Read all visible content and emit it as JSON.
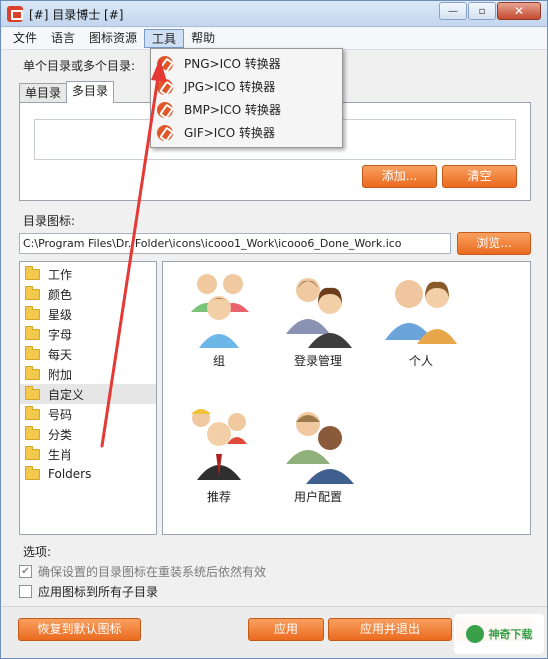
{
  "window": {
    "title": "[#] 目录博士 [#]",
    "minimize_glyph": "—",
    "maximize_glyph": "▫",
    "close_glyph": "✕"
  },
  "menu": {
    "items": [
      "文件",
      "语言",
      "图标资源",
      "工具",
      "帮助"
    ],
    "active_index": 3
  },
  "tools_menu": {
    "items": [
      "PNG>ICO 转换器",
      "JPG>ICO 转换器",
      "BMP>ICO 转换器",
      "GIF>ICO 转换器"
    ]
  },
  "directory_section": {
    "label": "单个目录或多个目录:",
    "tabs": [
      "单目录",
      "多目录"
    ],
    "active_tab": 1,
    "add_label": "添加...",
    "clear_label": "清空"
  },
  "icon_section": {
    "label": "目录图标:",
    "path": "C:\\Program Files\\Dr. Folder\\icons\\icooo1_Work\\icooo6_Done_Work.ico",
    "browse_label": "浏览..."
  },
  "folders": [
    "工作",
    "颜色",
    "星级",
    "字母",
    "每天",
    "附加",
    "自定义",
    "号码",
    "分类",
    "生肖",
    "Folders"
  ],
  "selected_folder": 6,
  "icons": [
    {
      "label": "组",
      "kind": "group"
    },
    {
      "label": "登录管理",
      "kind": "login"
    },
    {
      "label": "个人",
      "kind": "personal"
    },
    {
      "label": "推荐",
      "kind": "recommend"
    },
    {
      "label": "用户配置",
      "kind": "userconfig"
    }
  ],
  "options": {
    "label": "选项:",
    "opt1": "确保设置的目录图标在重装系统后依然有效",
    "opt1_checked": true,
    "opt2": "应用图标到所有子目录",
    "opt2_checked": false
  },
  "buttons": {
    "restore": "恢复到默认图标",
    "apply": "应用",
    "apply_exit": "应用并退出"
  },
  "watermark": {
    "text": "神奇下载"
  },
  "colors": {
    "accent": "#ea6a1e",
    "annotation": "#e53935"
  }
}
